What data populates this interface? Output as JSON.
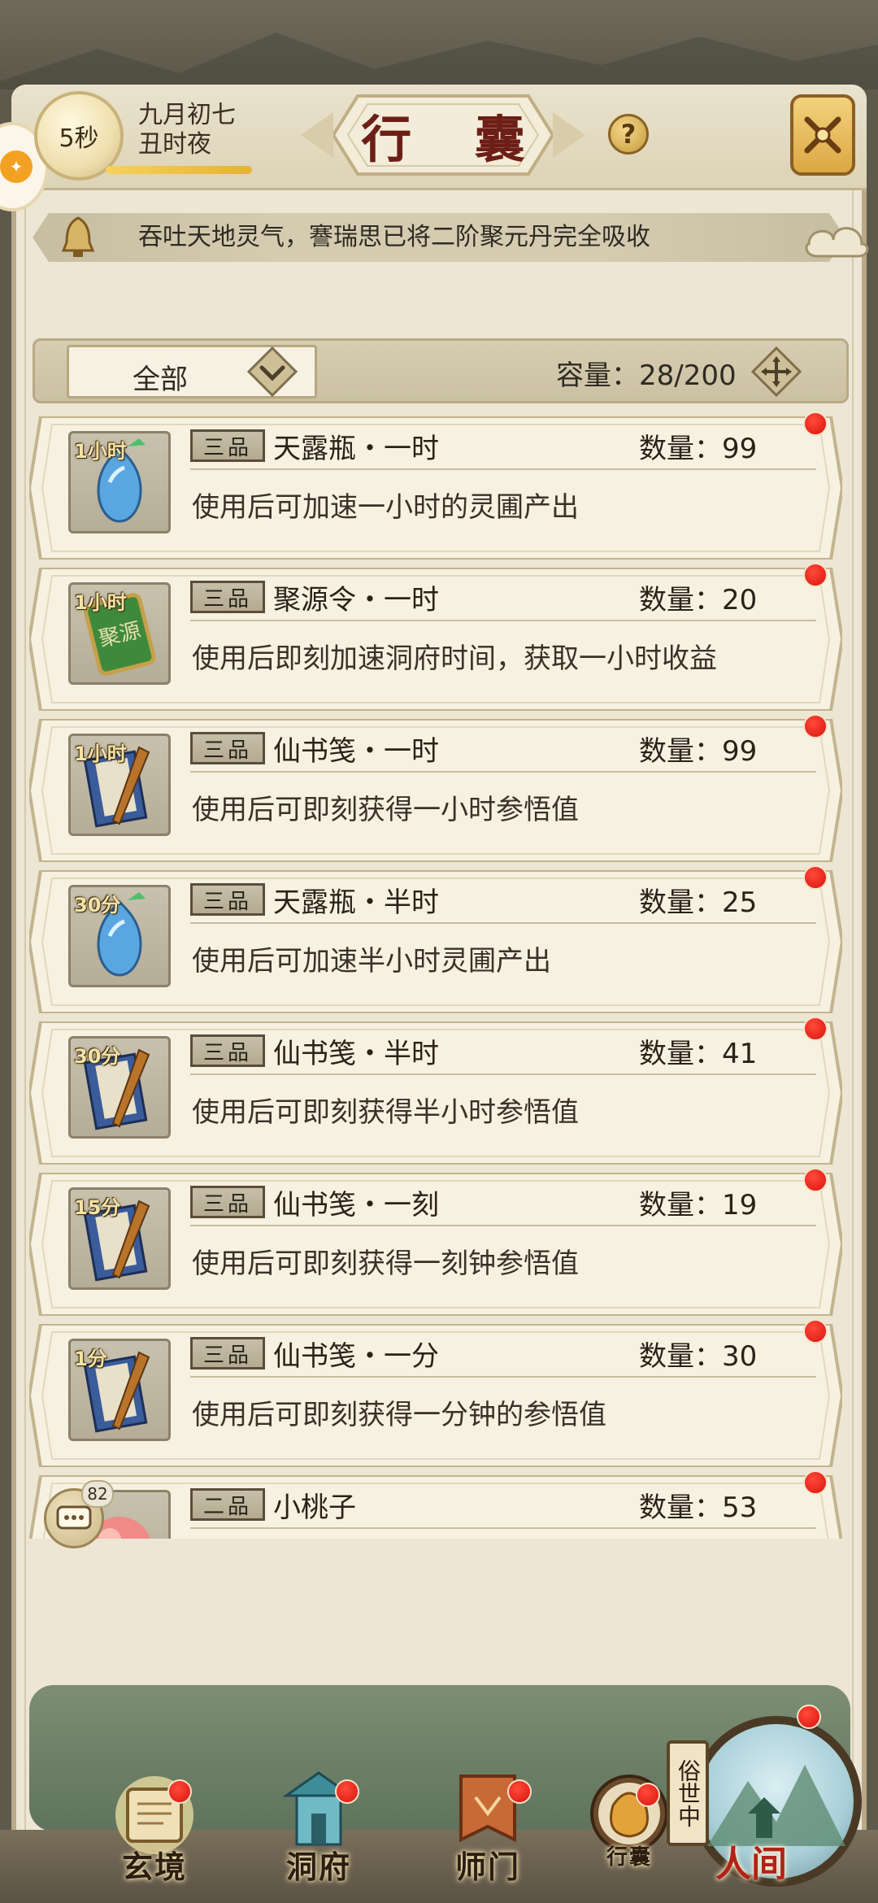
{
  "header": {
    "timer": "5秒",
    "timer_progress": 1.0,
    "date_line1": "九月初七",
    "date_line2": "丑时夜",
    "title": "行 囊",
    "help_symbol": "?"
  },
  "notice": {
    "text": "吞吐天地灵气，謇瑞思已将二阶聚元丹完全吸收"
  },
  "filter": {
    "selected": "全部",
    "capacity_label": "容量：28/200"
  },
  "items": [
    {
      "duration": "1小时",
      "grade": "三品",
      "name": "天露瓶・一时",
      "qty": "数量：99",
      "desc": "使用后可加速一小时的灵圃产出",
      "icon": "blue-vase-icon"
    },
    {
      "duration": "1小时",
      "grade": "三品",
      "name": "聚源令・一时",
      "qty": "数量：20",
      "desc": "使用后即刻加速洞府时间，获取一小时收益",
      "icon": "green-token-icon"
    },
    {
      "duration": "1小时",
      "grade": "三品",
      "name": "仙书笺・一时",
      "qty": "数量：99",
      "desc": "使用后可即刻获得一小时参悟值",
      "icon": "scroll-book-icon"
    },
    {
      "duration": "30分",
      "grade": "三品",
      "name": "天露瓶・半时",
      "qty": "数量：25",
      "desc": "使用后可加速半小时灵圃产出",
      "icon": "blue-vase-icon"
    },
    {
      "duration": "30分",
      "grade": "三品",
      "name": "仙书笺・半时",
      "qty": "数量：41",
      "desc": "使用后可即刻获得半小时参悟值",
      "icon": "scroll-book-icon"
    },
    {
      "duration": "15分",
      "grade": "三品",
      "name": "仙书笺・一刻",
      "qty": "数量：19",
      "desc": "使用后可即刻获得一刻钟参悟值",
      "icon": "scroll-book-icon"
    },
    {
      "duration": "1分",
      "grade": "三品",
      "name": "仙书笺・一分",
      "qty": "数量：30",
      "desc": "使用后可即刻获得一分钟的参悟值",
      "icon": "scroll-book-icon"
    },
    {
      "duration": "",
      "grade": "二品",
      "name": "小桃子",
      "qty": "数量：53",
      "desc": "",
      "icon": "peach-icon"
    }
  ],
  "chat": {
    "count": "82"
  },
  "nav": {
    "xuanjing": "玄境",
    "dongfu": "洞府",
    "shimen": "师门",
    "xingnang": "行囊",
    "world_tag": "俗世中",
    "renjian": "人间"
  },
  "colors": {
    "accent_red": "#d9140d",
    "title_red": "#6c1f17",
    "panel_bg": "#ede6d4",
    "nav_green": "#5f735c"
  }
}
